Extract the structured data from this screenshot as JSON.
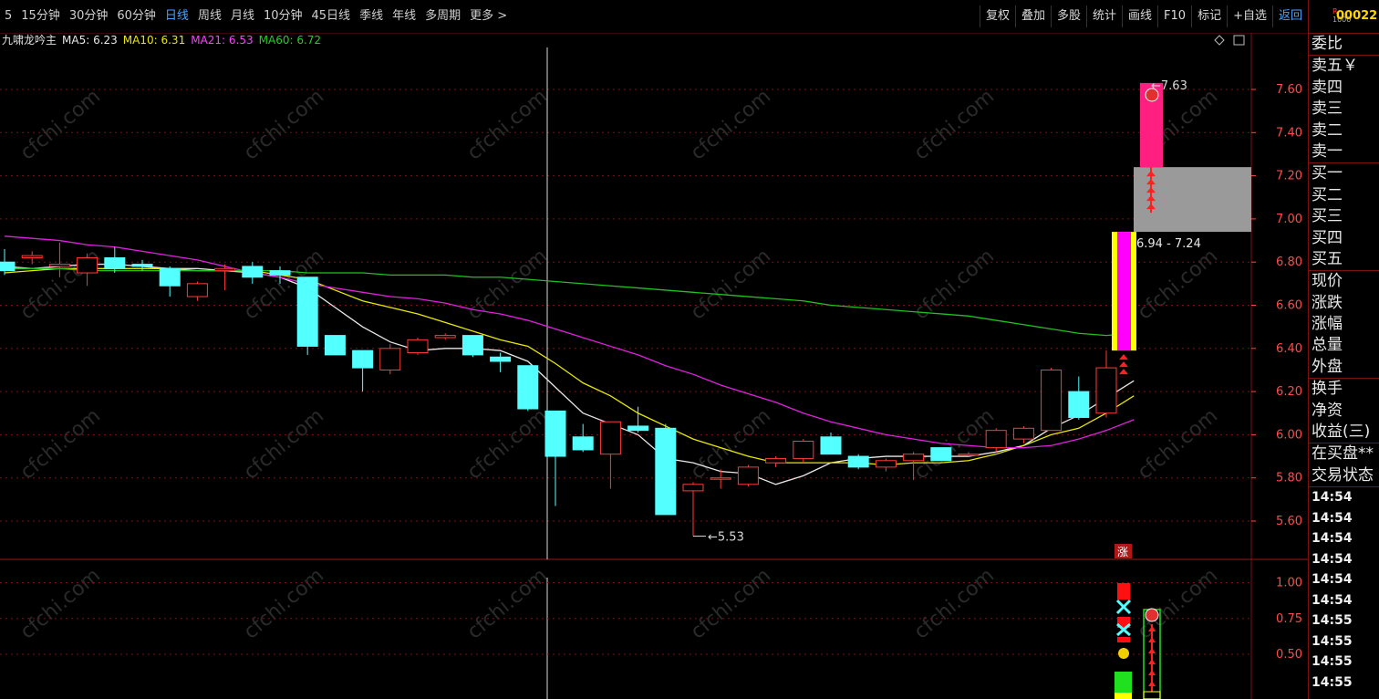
{
  "period_tabs": [
    "5",
    "15分钟",
    "30分钟",
    "60分钟",
    "日线",
    "周线",
    "月线",
    "10分钟",
    "45日线",
    "季线",
    "年线",
    "多周期",
    "更多 >"
  ],
  "period_active": 4,
  "toolbar": [
    "复权",
    "叠加",
    "多股",
    "统计",
    "画线",
    "F10",
    "标记",
    "+自选",
    "返回"
  ],
  "toolbar_active": 8,
  "indicator": {
    "name": "九啸龙吟主",
    "ma5": "MA5: 6.23",
    "ma10": "MA10: 6.31",
    "ma21": "MA21: 6.53",
    "ma60": "MA60: 6.72"
  },
  "colors": {
    "ma5": "#e8e8e8",
    "ma10": "#e8e800",
    "ma21": "#e020e0",
    "ma60": "#20c020",
    "up": "#ff3a3a",
    "down": "#54ffff",
    "grid": "#7a1010",
    "axis": "#ff4a4a"
  },
  "watermark": "cfchi.com",
  "chart_data": {
    "type": "candlestick",
    "ylim": [
      5.45,
      7.75
    ],
    "y_ticks": [
      "7.60",
      "7.40",
      "7.20",
      "7.00",
      "6.80",
      "6.60",
      "6.40",
      "6.20",
      "6.00",
      "5.80",
      "5.60"
    ],
    "y_tick_values": [
      7.6,
      7.4,
      7.2,
      7.0,
      6.8,
      6.6,
      6.4,
      6.2,
      6.0,
      5.8,
      5.6
    ],
    "candles": [
      {
        "o": 6.8,
        "h": 6.86,
        "l": 6.74,
        "c": 6.76
      },
      {
        "o": 6.82,
        "h": 6.85,
        "l": 6.79,
        "c": 6.83
      },
      {
        "o": 6.78,
        "h": 6.89,
        "l": 6.73,
        "c": 6.79
      },
      {
        "o": 6.75,
        "h": 6.84,
        "l": 6.69,
        "c": 6.82
      },
      {
        "o": 6.82,
        "h": 6.87,
        "l": 6.75,
        "c": 6.77
      },
      {
        "o": 6.79,
        "h": 6.81,
        "l": 6.76,
        "c": 6.78
      },
      {
        "o": 6.77,
        "h": 6.78,
        "l": 6.64,
        "c": 6.69
      },
      {
        "o": 6.64,
        "h": 6.71,
        "l": 6.62,
        "c": 6.7
      },
      {
        "o": 6.76,
        "h": 6.79,
        "l": 6.67,
        "c": 6.77
      },
      {
        "o": 6.78,
        "h": 6.8,
        "l": 6.7,
        "c": 6.73
      },
      {
        "o": 6.76,
        "h": 6.78,
        "l": 6.7,
        "c": 6.74
      },
      {
        "o": 6.73,
        "h": 6.73,
        "l": 6.37,
        "c": 6.41
      },
      {
        "o": 6.46,
        "h": 6.46,
        "l": 6.37,
        "c": 6.37
      },
      {
        "o": 6.39,
        "h": 6.39,
        "l": 6.2,
        "c": 6.31
      },
      {
        "o": 6.3,
        "h": 6.42,
        "l": 6.28,
        "c": 6.4
      },
      {
        "o": 6.38,
        "h": 6.45,
        "l": 6.37,
        "c": 6.44
      },
      {
        "o": 6.45,
        "h": 6.47,
        "l": 6.44,
        "c": 6.46
      },
      {
        "o": 6.46,
        "h": 6.46,
        "l": 6.36,
        "c": 6.37
      },
      {
        "o": 6.36,
        "h": 6.38,
        "l": 6.29,
        "c": 6.34
      },
      {
        "o": 6.32,
        "h": 6.32,
        "l": 6.11,
        "c": 6.12
      },
      {
        "o": 6.11,
        "h": 6.11,
        "l": 5.67,
        "c": 5.9
      },
      {
        "o": 5.99,
        "h": 6.05,
        "l": 5.92,
        "c": 5.93
      },
      {
        "o": 5.91,
        "h": 6.06,
        "l": 5.75,
        "c": 6.06
      },
      {
        "o": 6.04,
        "h": 6.13,
        "l": 6.01,
        "c": 6.02
      },
      {
        "o": 6.03,
        "h": 6.05,
        "l": 5.63,
        "c": 5.63
      },
      {
        "o": 5.74,
        "h": 5.78,
        "l": 5.53,
        "c": 5.77
      },
      {
        "o": 5.8,
        "h": 5.84,
        "l": 5.75,
        "c": 5.8
      },
      {
        "o": 5.77,
        "h": 5.86,
        "l": 5.76,
        "c": 5.85
      },
      {
        "o": 5.87,
        "h": 5.9,
        "l": 5.85,
        "c": 5.89
      },
      {
        "o": 5.89,
        "h": 5.98,
        "l": 5.87,
        "c": 5.97
      },
      {
        "o": 5.99,
        "h": 6.01,
        "l": 5.91,
        "c": 5.91
      },
      {
        "o": 5.9,
        "h": 5.91,
        "l": 5.84,
        "c": 5.85
      },
      {
        "o": 5.85,
        "h": 5.89,
        "l": 5.83,
        "c": 5.88
      },
      {
        "o": 5.88,
        "h": 5.92,
        "l": 5.79,
        "c": 5.91
      },
      {
        "o": 5.94,
        "h": 5.94,
        "l": 5.88,
        "c": 5.88
      },
      {
        "o": 5.91,
        "h": 5.92,
        "l": 5.9,
        "c": 5.91
      },
      {
        "o": 5.94,
        "h": 6.03,
        "l": 5.92,
        "c": 6.02
      },
      {
        "o": 5.98,
        "h": 6.04,
        "l": 5.96,
        "c": 6.03
      },
      {
        "o": 6.02,
        "h": 6.31,
        "l": 6.02,
        "c": 6.3
      },
      {
        "o": 6.2,
        "h": 6.27,
        "l": 6.07,
        "c": 6.08
      },
      {
        "o": 6.1,
        "h": 6.39,
        "l": 6.08,
        "c": 6.31
      }
    ],
    "ma_series": [
      {
        "name": "MA5",
        "color_key": "ma5",
        "values": [
          6.78,
          6.77,
          6.78,
          6.79,
          6.79,
          6.78,
          6.77,
          6.77,
          6.76,
          6.75,
          6.73,
          6.68,
          6.59,
          6.5,
          6.43,
          6.39,
          6.4,
          6.4,
          6.39,
          6.34,
          6.22,
          6.1,
          6.05,
          6.0,
          5.89,
          5.87,
          5.83,
          5.82,
          5.77,
          5.81,
          5.87,
          5.89,
          5.9,
          5.9,
          5.9,
          5.9,
          5.92,
          5.95,
          6.03,
          6.09,
          6.17,
          6.25
        ]
      },
      {
        "name": "MA10",
        "color_key": "ma10",
        "values": [
          6.75,
          6.76,
          6.77,
          6.77,
          6.77,
          6.77,
          6.77,
          6.76,
          6.76,
          6.76,
          6.74,
          6.72,
          6.67,
          6.62,
          6.59,
          6.56,
          6.52,
          6.48,
          6.44,
          6.41,
          6.33,
          6.24,
          6.18,
          6.1,
          6.04,
          5.98,
          5.94,
          5.9,
          5.87,
          5.87,
          5.87,
          5.87,
          5.86,
          5.87,
          5.87,
          5.88,
          5.91,
          5.95,
          6.0,
          6.03,
          6.1,
          6.18
        ]
      },
      {
        "name": "MA21",
        "color_key": "ma21",
        "values": [
          6.92,
          6.91,
          6.9,
          6.88,
          6.87,
          6.85,
          6.83,
          6.81,
          6.78,
          6.75,
          6.73,
          6.7,
          6.68,
          6.66,
          6.64,
          6.63,
          6.61,
          6.58,
          6.56,
          6.53,
          6.49,
          6.45,
          6.41,
          6.37,
          6.32,
          6.28,
          6.23,
          6.19,
          6.15,
          6.1,
          6.06,
          6.03,
          6.0,
          5.98,
          5.96,
          5.95,
          5.94,
          5.94,
          5.95,
          5.98,
          6.02,
          6.07
        ]
      },
      {
        "name": "MA60",
        "color_key": "ma60",
        "values": [
          6.77,
          6.77,
          6.77,
          6.76,
          6.76,
          6.76,
          6.76,
          6.76,
          6.76,
          6.76,
          6.76,
          6.75,
          6.75,
          6.75,
          6.74,
          6.74,
          6.74,
          6.73,
          6.73,
          6.72,
          6.71,
          6.7,
          6.69,
          6.68,
          6.67,
          6.66,
          6.65,
          6.64,
          6.63,
          6.62,
          6.6,
          6.59,
          6.58,
          6.57,
          6.56,
          6.55,
          6.53,
          6.51,
          6.49,
          6.47,
          6.46,
          6.47
        ]
      }
    ],
    "low_label": "5.53",
    "high_label": "7.63",
    "range_label": "6.94 - 7.24",
    "target": {
      "bar_low": 7.24,
      "bar_high": 7.63,
      "zone_low": 6.94,
      "zone_high": 7.24,
      "breakout_low": 6.39,
      "breakout_high": 6.94
    },
    "sub_ticks": [
      "1.00",
      "0.75",
      "0.50"
    ],
    "sub_tick_values": [
      1.0,
      0.75,
      0.5
    ],
    "sub_ylim": [
      0.22,
      1.08
    ],
    "zhang_label": "涨"
  },
  "side_panel": {
    "r_label": "R",
    "r_sub": "1000",
    "code": "00022",
    "rows": [
      "委比",
      "卖五￥",
      "卖四",
      "卖三",
      "卖二",
      "卖一",
      "买一",
      "买二",
      "买三",
      "买四",
      "买五",
      "现价",
      "涨跌",
      "涨幅",
      "总量",
      "外盘",
      "换手",
      "净资",
      "收益(三)",
      "在买盘**",
      "交易状态"
    ],
    "sep_before": [
      1,
      6,
      11,
      16,
      19
    ],
    "times": [
      "14:54",
      "14:54",
      "14:54",
      "14:54",
      "14:54",
      "14:54",
      "14:55",
      "14:55",
      "14:55",
      "14:55"
    ]
  }
}
